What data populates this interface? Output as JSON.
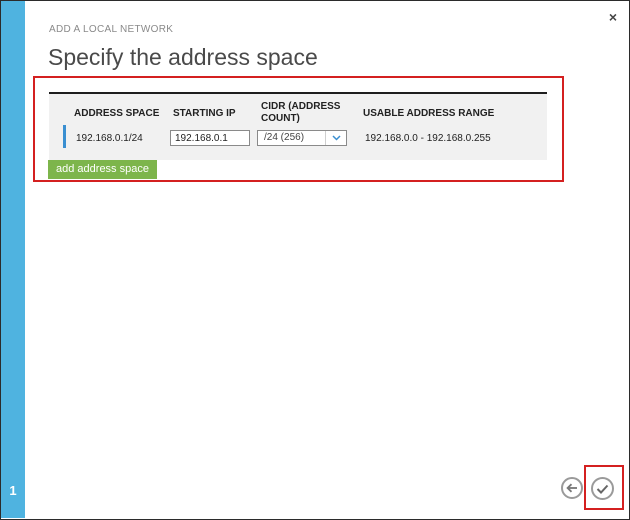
{
  "wizard": {
    "subtitle": "ADD A LOCAL NETWORK",
    "title": "Specify the address space",
    "step_number": "1",
    "close_label": "×"
  },
  "table": {
    "headers": {
      "address_space": "ADDRESS SPACE",
      "starting_ip": "STARTING IP",
      "cidr_line1": "CIDR (ADDRESS",
      "cidr_line2": "COUNT)",
      "usable_range": "USABLE ADDRESS RANGE"
    },
    "rows": [
      {
        "address_space": "192.168.0.1/24",
        "starting_ip": "192.168.0.1",
        "cidr": "/24 (256)",
        "usable_range": "192.168.0.0 - 192.168.0.255"
      }
    ]
  },
  "actions": {
    "add_address_space_label": "add address space"
  },
  "icons": {
    "close": "close-icon",
    "dropdown": "chevron-down-icon",
    "back": "arrow-left-icon",
    "finish": "checkmark-icon"
  },
  "colors": {
    "side_strip": "#4fb3e0",
    "accent_blue": "#3a8fd1",
    "add_button": "#7db54b",
    "highlight_red": "#d42020"
  }
}
